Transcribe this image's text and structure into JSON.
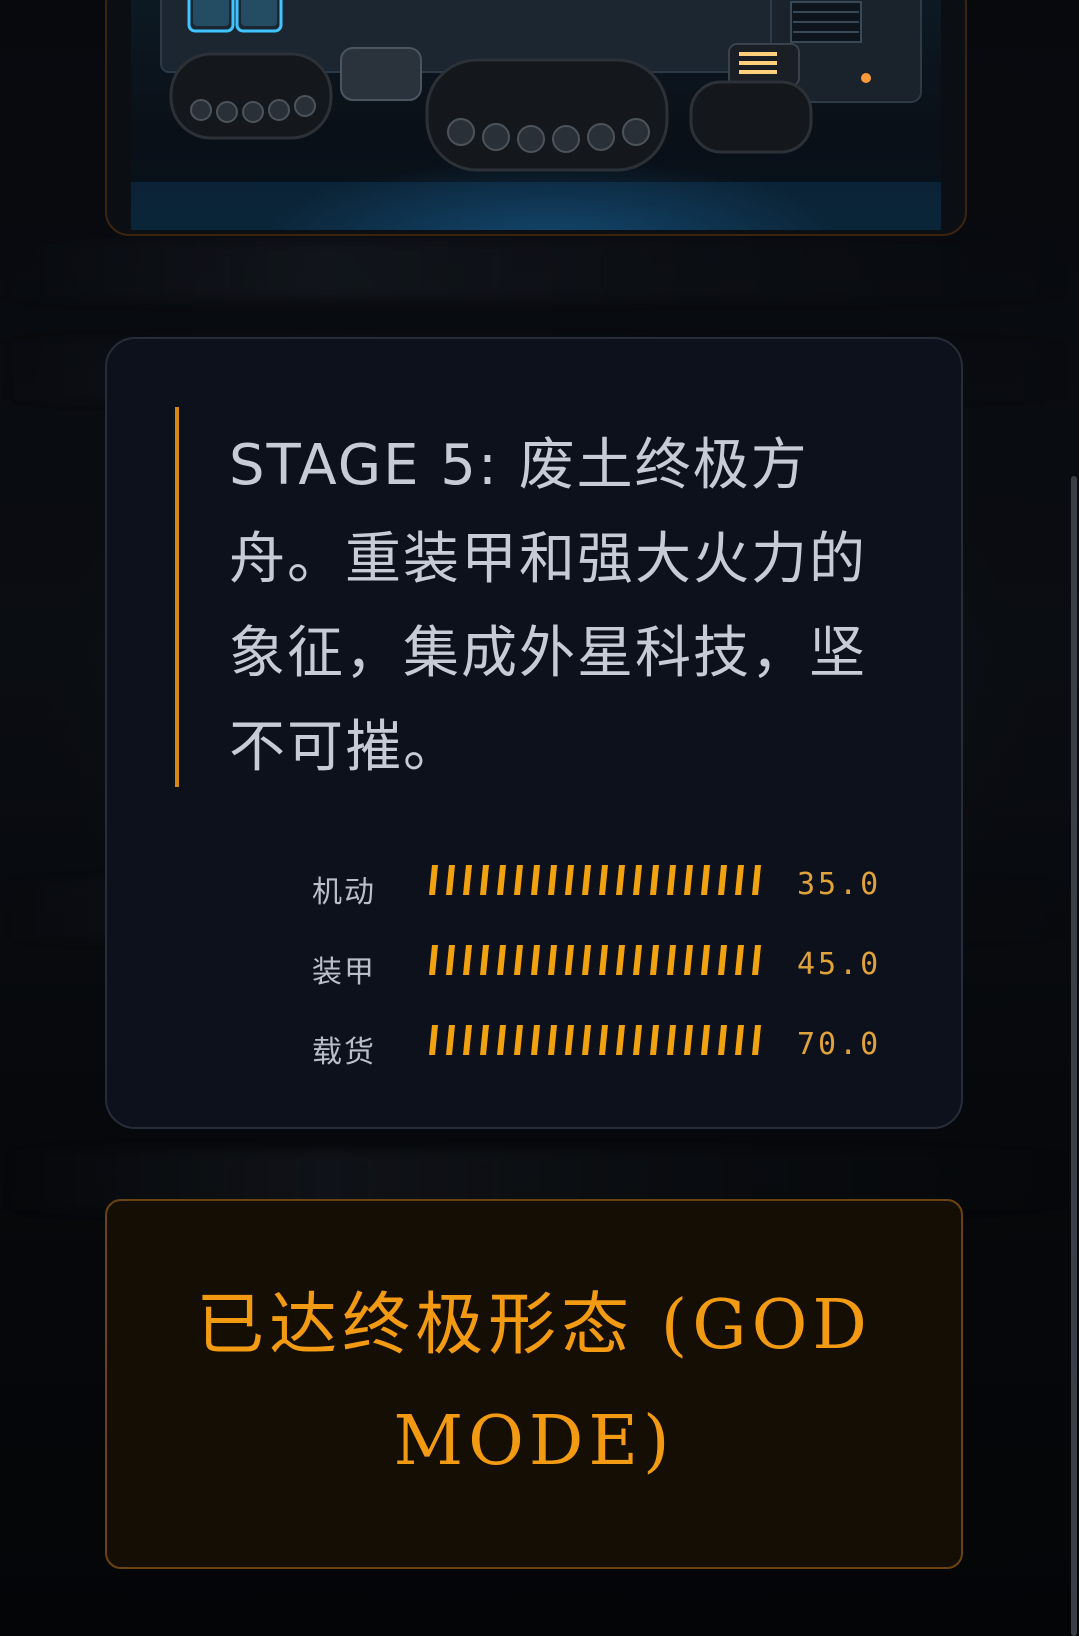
{
  "stage": {
    "description": "STAGE 5: 废土终极方舟。重装甲和强大火力的象征，集成外星科技，坚不可摧。"
  },
  "stats": [
    {
      "label": "机动",
      "value_text": "35.0",
      "level": 35.0
    },
    {
      "label": "装甲",
      "value_text": "45.0",
      "level": 45.0
    },
    {
      "label": "载货",
      "value_text": "70.0",
      "level": 70.0
    }
  ],
  "status": {
    "label": "已达终极形态 (GOD MODE)"
  },
  "colors": {
    "accent": "#f29a12",
    "bar": "#f2a20f",
    "text": "#c6cbd6",
    "card": "#0d111b"
  }
}
